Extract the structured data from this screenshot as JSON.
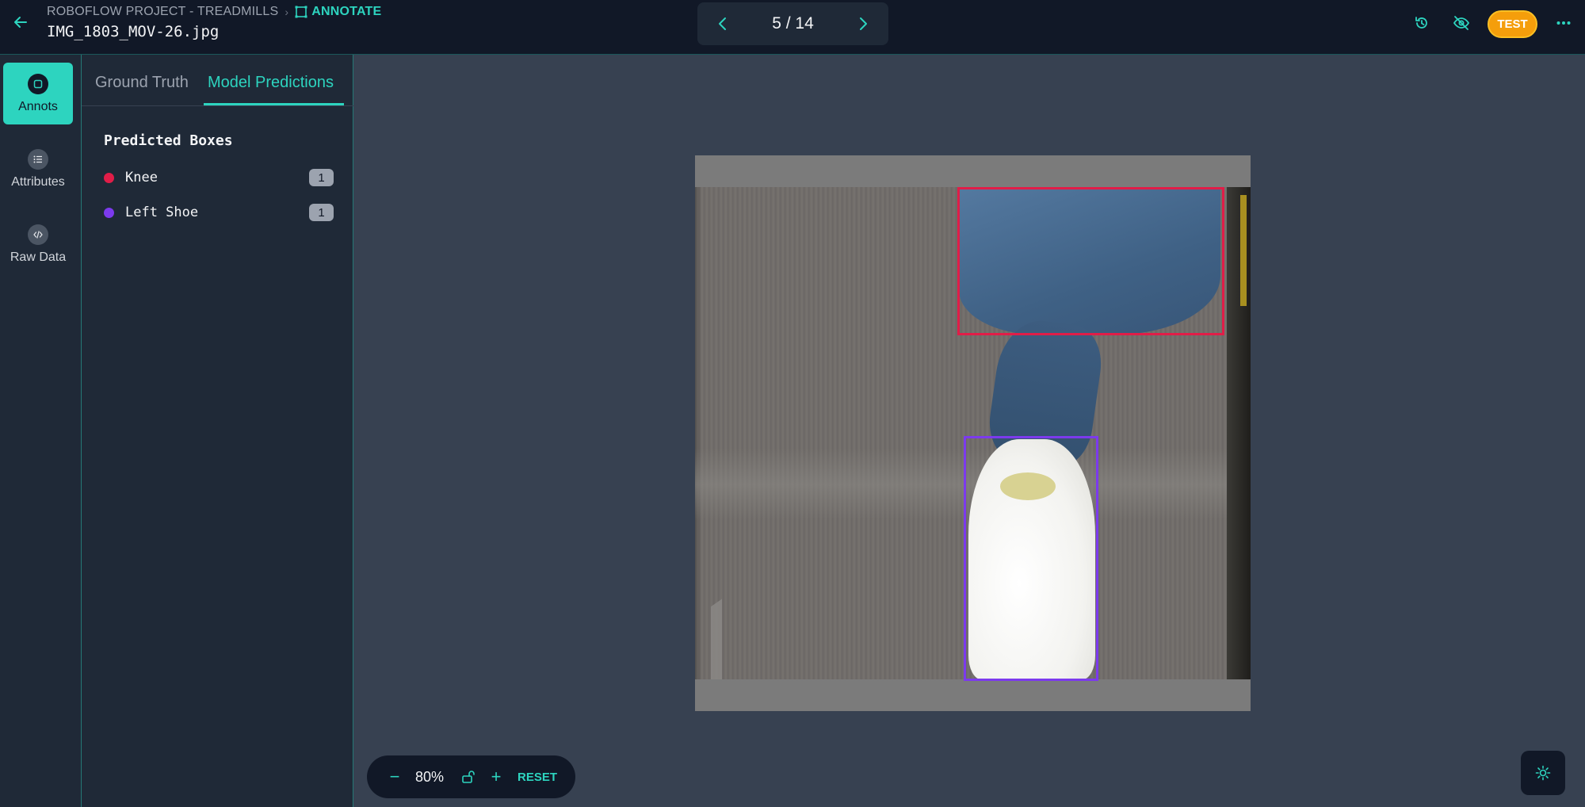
{
  "header": {
    "project": "ROBOFLOW PROJECT - TREADMILLS",
    "breadcrumb_sep": "›",
    "mode": "ANNOTATE",
    "filename": "IMG_1803_MOV-26.jpg",
    "pager": {
      "text": "5 / 14"
    },
    "badge": "TEST"
  },
  "rail": {
    "items": [
      {
        "label": "Annots",
        "active": true
      },
      {
        "label": "Attributes",
        "active": false
      },
      {
        "label": "Raw Data",
        "active": false
      }
    ]
  },
  "panel": {
    "tabs": [
      {
        "label": "Ground Truth",
        "active": false
      },
      {
        "label": "Model Predictions",
        "active": true
      }
    ],
    "section_title": "Predicted Boxes",
    "classes": [
      {
        "name": "Knee",
        "count": "1",
        "color": "#e11d48"
      },
      {
        "name": "Left Shoe",
        "count": "1",
        "color": "#7c3aed"
      }
    ]
  },
  "canvas": {
    "boxes": [
      {
        "label": "Knee",
        "color": "#e11d48"
      },
      {
        "label": "Left Shoe",
        "color": "#7c3aed"
      }
    ]
  },
  "zoom": {
    "value": "80%",
    "minus": "−",
    "plus": "+",
    "reset": "RESET"
  },
  "colors": {
    "accent": "#2dd4bf",
    "badge": "#f59e0b"
  }
}
